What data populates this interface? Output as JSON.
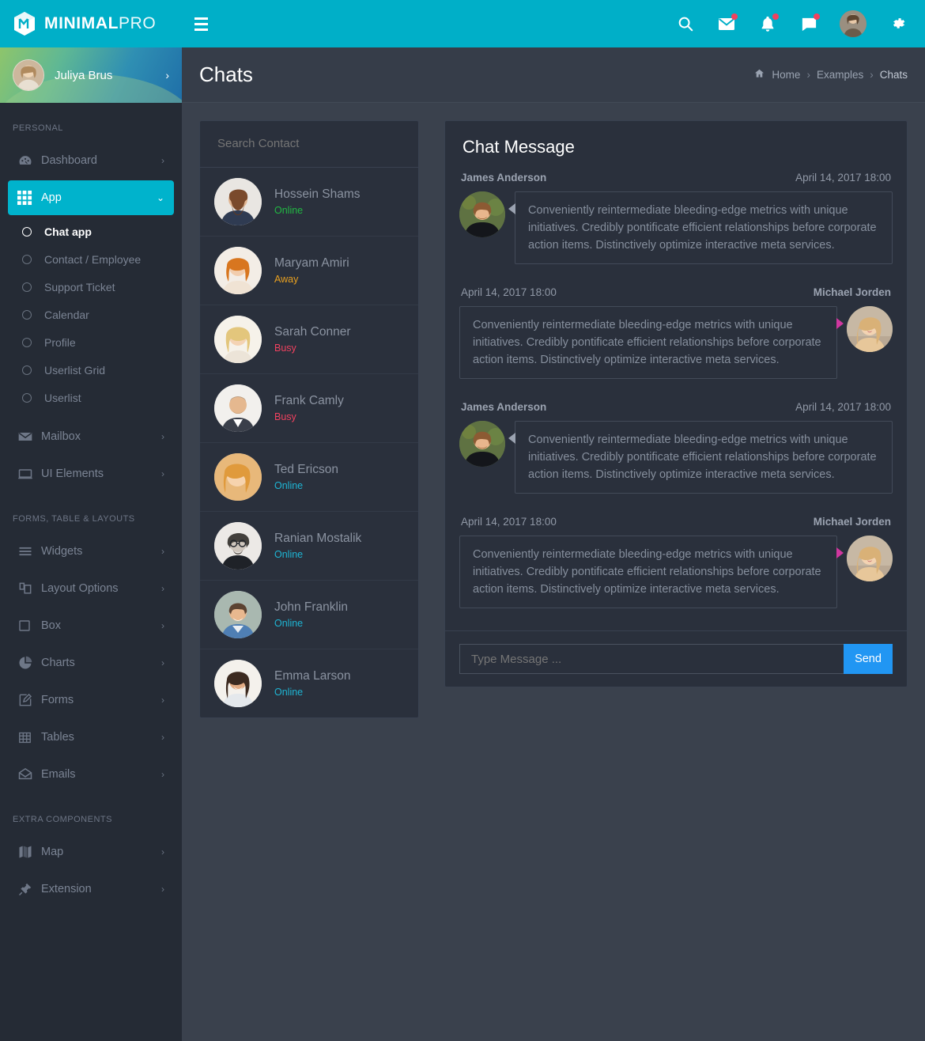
{
  "brand": {
    "bold": "MINIMAL",
    "light": "PRO",
    "logo_icon": "cube-logo-icon"
  },
  "topbar": {
    "menu_toggle_icon": "hamburger-icon",
    "icons": [
      {
        "name": "search-icon",
        "badge": false
      },
      {
        "name": "mail-icon",
        "badge": true
      },
      {
        "name": "bell-icon",
        "badge": true
      },
      {
        "name": "chat-icon",
        "badge": true
      }
    ],
    "avatar_name": "user-avatar",
    "settings_icon": "gear-icon",
    "background": "#00afc8",
    "badge_color": "#f0415f"
  },
  "sidebar": {
    "profile": {
      "name": "Juliya Brus",
      "chevron": "›",
      "avatar": "profile-avatar"
    },
    "sections": [
      {
        "heading": "PERSONAL",
        "items": [
          {
            "label": "Dashboard",
            "icon": "dashboard-icon",
            "chevron": "›",
            "active": false
          },
          {
            "label": "App",
            "icon": "grid-icon",
            "chevron": "⌄",
            "active": true,
            "children": [
              {
                "label": "Chat app",
                "active": true
              },
              {
                "label": "Contact / Employee",
                "active": false
              },
              {
                "label": "Support Ticket",
                "active": false
              },
              {
                "label": "Calendar",
                "active": false
              },
              {
                "label": "Profile",
                "active": false
              },
              {
                "label": "Userlist Grid",
                "active": false
              },
              {
                "label": "Userlist",
                "active": false
              }
            ]
          },
          {
            "label": "Mailbox",
            "icon": "envelope-icon",
            "chevron": "›",
            "active": false
          },
          {
            "label": "UI Elements",
            "icon": "window-icon",
            "chevron": "›",
            "active": false
          }
        ]
      },
      {
        "heading": "FORMS, TABLE & LAYOUTS",
        "items": [
          {
            "label": "Widgets",
            "icon": "list-icon",
            "chevron": "›",
            "active": false
          },
          {
            "label": "Layout Options",
            "icon": "layers-icon",
            "chevron": "›",
            "active": false
          },
          {
            "label": "Box",
            "icon": "square-icon",
            "chevron": "›",
            "active": false
          },
          {
            "label": "Charts",
            "icon": "pie-chart-icon",
            "chevron": "›",
            "active": false
          },
          {
            "label": "Forms",
            "icon": "edit-icon",
            "chevron": "›",
            "active": false
          },
          {
            "label": "Tables",
            "icon": "table-icon",
            "chevron": "›",
            "active": false
          },
          {
            "label": "Emails",
            "icon": "open-envelope-icon",
            "chevron": "›",
            "active": false
          }
        ]
      },
      {
        "heading": "EXTRA COMPONENTS",
        "items": [
          {
            "label": "Map",
            "icon": "map-icon",
            "chevron": "›",
            "active": false
          },
          {
            "label": "Extension",
            "icon": "plug-icon",
            "chevron": "›",
            "active": false
          }
        ]
      }
    ]
  },
  "page": {
    "title": "Chats",
    "breadcrumb": {
      "home_icon": "home-icon",
      "items": [
        "Home",
        "Examples",
        "Chats"
      ],
      "separator": "›"
    }
  },
  "contacts_panel": {
    "search_placeholder": "Search Contact",
    "contacts": [
      {
        "name": "Hossein Shams",
        "status": "Online",
        "status_color": "#21b843",
        "avatar": "contact-avatar-hossein"
      },
      {
        "name": "Maryam Amiri",
        "status": "Away",
        "status_color": "#e8a020",
        "avatar": "contact-avatar-maryam"
      },
      {
        "name": "Sarah Conner",
        "status": "Busy",
        "status_color": "#f0415f",
        "avatar": "contact-avatar-sarah"
      },
      {
        "name": "Frank Camly",
        "status": "Busy",
        "status_color": "#f0415f",
        "avatar": "contact-avatar-frank"
      },
      {
        "name": "Ted Ericson",
        "status": "Online",
        "status_color": "#1eb5d4",
        "avatar": "contact-avatar-ted"
      },
      {
        "name": "Ranian Mostalik",
        "status": "Online",
        "status_color": "#1eb5d4",
        "avatar": "contact-avatar-ranian"
      },
      {
        "name": "John Franklin",
        "status": "Online",
        "status_color": "#1eb5d4",
        "avatar": "contact-avatar-john"
      },
      {
        "name": "Emma Larson",
        "status": "Online",
        "status_color": "#1eb5d4",
        "avatar": "contact-avatar-emma"
      }
    ]
  },
  "chat_panel": {
    "title": "Chat Message",
    "messages": [
      {
        "side": "left",
        "author": "James Anderson",
        "time": "April 14, 2017 18:00",
        "text": "Conveniently reintermediate bleeding-edge metrics with unique initiatives. Credibly pontificate efficient relationships before corporate action items. Distinctively optimize interactive meta services.",
        "avatar": "message-avatar-james"
      },
      {
        "side": "right",
        "author": "Michael Jorden",
        "time": "April 14, 2017 18:00",
        "text": "Conveniently reintermediate bleeding-edge metrics with unique initiatives. Credibly pontificate efficient relationships before corporate action items. Distinctively optimize interactive meta services.",
        "avatar": "message-avatar-michael"
      },
      {
        "side": "left",
        "author": "James Anderson",
        "time": "April 14, 2017 18:00",
        "text": "Conveniently reintermediate bleeding-edge metrics with unique initiatives. Credibly pontificate efficient relationships before corporate action items. Distinctively optimize interactive meta services.",
        "avatar": "message-avatar-james"
      },
      {
        "side": "right",
        "author": "Michael Jorden",
        "time": "April 14, 2017 18:00",
        "text": "Conveniently reintermediate bleeding-edge metrics with unique initiatives. Credibly pontificate efficient relationships before corporate action items. Distinctively optimize interactive meta services.",
        "avatar": "message-avatar-michael"
      }
    ],
    "composer": {
      "placeholder": "Type Message ...",
      "send_label": "Send",
      "send_color": "#2196f3"
    }
  },
  "theme": {
    "accent": "#00afc8",
    "sidebar_bg": "#252b35",
    "content_bg": "#3a414d",
    "card_bg": "#2a303c"
  }
}
